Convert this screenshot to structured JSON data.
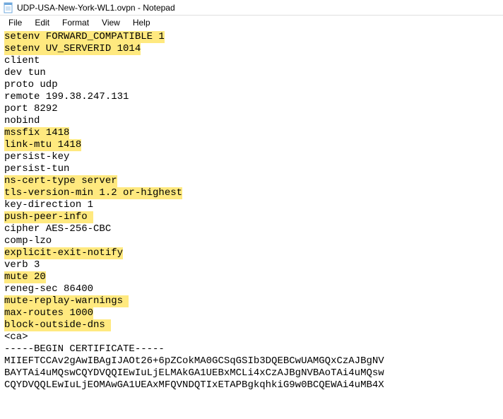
{
  "window": {
    "title": "UDP-USA-New-York-WL1.ovpn - Notepad"
  },
  "menu": {
    "file": "File",
    "edit": "Edit",
    "format": "Format",
    "view": "View",
    "help": "Help"
  },
  "content": {
    "lines": [
      {
        "text": "setenv FORWARD_COMPATIBLE 1",
        "highlighted": true
      },
      {
        "text": "setenv UV_SERVERID 1014",
        "highlighted": true
      },
      {
        "text": "client",
        "highlighted": false
      },
      {
        "text": "dev tun",
        "highlighted": false
      },
      {
        "text": "proto udp",
        "highlighted": false
      },
      {
        "text": "remote 199.38.247.131",
        "highlighted": false
      },
      {
        "text": "port 8292",
        "highlighted": false
      },
      {
        "text": "nobind",
        "highlighted": false
      },
      {
        "text": "mssfix 1418",
        "highlighted": true
      },
      {
        "text": "link-mtu 1418",
        "highlighted": true
      },
      {
        "text": "persist-key",
        "highlighted": false
      },
      {
        "text": "persist-tun",
        "highlighted": false
      },
      {
        "text": "ns-cert-type server",
        "highlighted": true
      },
      {
        "text": "tls-version-min 1.2 or-highest",
        "highlighted": true
      },
      {
        "text": "key-direction 1",
        "highlighted": false
      },
      {
        "text": "push-peer-info ",
        "highlighted": true
      },
      {
        "text": "cipher AES-256-CBC",
        "highlighted": false
      },
      {
        "text": "comp-lzo",
        "highlighted": false
      },
      {
        "text": "explicit-exit-notify",
        "highlighted": true
      },
      {
        "text": "verb 3",
        "highlighted": false
      },
      {
        "text": "mute 20",
        "highlighted": true
      },
      {
        "text": "reneg-sec 86400",
        "highlighted": false
      },
      {
        "text": "mute-replay-warnings ",
        "highlighted": true
      },
      {
        "text": "max-routes 1000",
        "highlighted": true
      },
      {
        "text": "block-outside-dns ",
        "highlighted": true
      },
      {
        "text": "<ca>",
        "highlighted": false
      },
      {
        "text": "-----BEGIN CERTIFICATE-----",
        "highlighted": false
      },
      {
        "text": "MIIEFTCCAv2gAwIBAgIJAOt26+6pZCokMA0GCSqGSIb3DQEBCwUAMGQxCzAJBgNV",
        "highlighted": false
      },
      {
        "text": "BAYTAi4uMQswCQYDVQQIEwIuLjELMAkGA1UEBxMCLi4xCzAJBgNVBAoTAi4uMQsw",
        "highlighted": false
      },
      {
        "text": "CQYDVQQLEwIuLjEOMAwGA1UEAxMFQVNDQTIxETAPBgkqhkiG9w0BCQEWAi4uMB4X",
        "highlighted": false
      }
    ]
  }
}
